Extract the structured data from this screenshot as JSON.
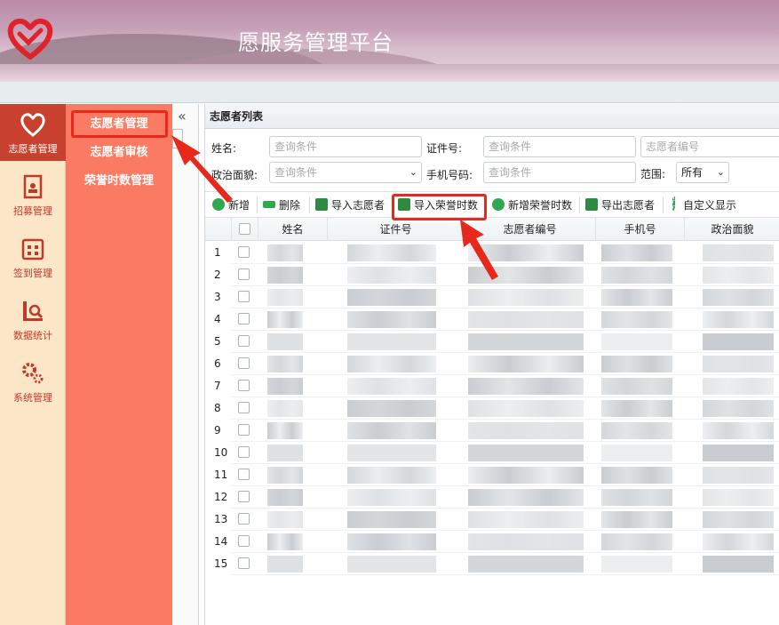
{
  "header": {
    "title": "愿服务管理平台"
  },
  "rail": {
    "items": [
      {
        "label": "志愿者管理",
        "icon": "heart-hand-icon",
        "active": true
      },
      {
        "label": "招募管理",
        "icon": "document-user-icon"
      },
      {
        "label": "签到管理",
        "icon": "calendar-icon"
      },
      {
        "label": "数据统计",
        "icon": "chart-search-icon"
      },
      {
        "label": "系统管理",
        "icon": "gears-icon"
      }
    ]
  },
  "submenu": {
    "items": [
      {
        "label": "志愿者管理"
      },
      {
        "label": "志愿者审核"
      },
      {
        "label": "荣誉时数管理"
      }
    ]
  },
  "collapse": {
    "label": "«"
  },
  "panel": {
    "title": "志愿者列表"
  },
  "filters": {
    "name_label": "姓名:",
    "name_placeholder": "查询条件",
    "id_label": "证件号:",
    "id_placeholder": "查询条件",
    "code_placeholder": "志愿者编号",
    "politics_label": "政治面貌:",
    "politics_placeholder": "查询条件",
    "phone_label": "手机号码:",
    "phone_placeholder": "查询条件",
    "scope_label": "范围:",
    "scope_value": "所有"
  },
  "toolbar": {
    "add": "新增",
    "delete": "删除",
    "import_volunteer": "导入志愿者",
    "import_honor": "导入荣誉时数",
    "add_honor": "新增荣誉时数",
    "export_volunteer": "导出志愿者",
    "custom_display": "自定义显示"
  },
  "grid": {
    "columns": [
      "姓名",
      "证件号",
      "志愿者编号",
      "手机号",
      "政治面貌"
    ],
    "rows": [
      "1",
      "2",
      "3",
      "4",
      "5",
      "6",
      "7",
      "8",
      "9",
      "10",
      "11",
      "12",
      "13",
      "14",
      "15"
    ]
  },
  "colors": {
    "accent_red": "#c8412e",
    "submenu_bg": "#fa7a63",
    "rail_bg": "#fbe6c7",
    "highlight": "#e8281b"
  }
}
